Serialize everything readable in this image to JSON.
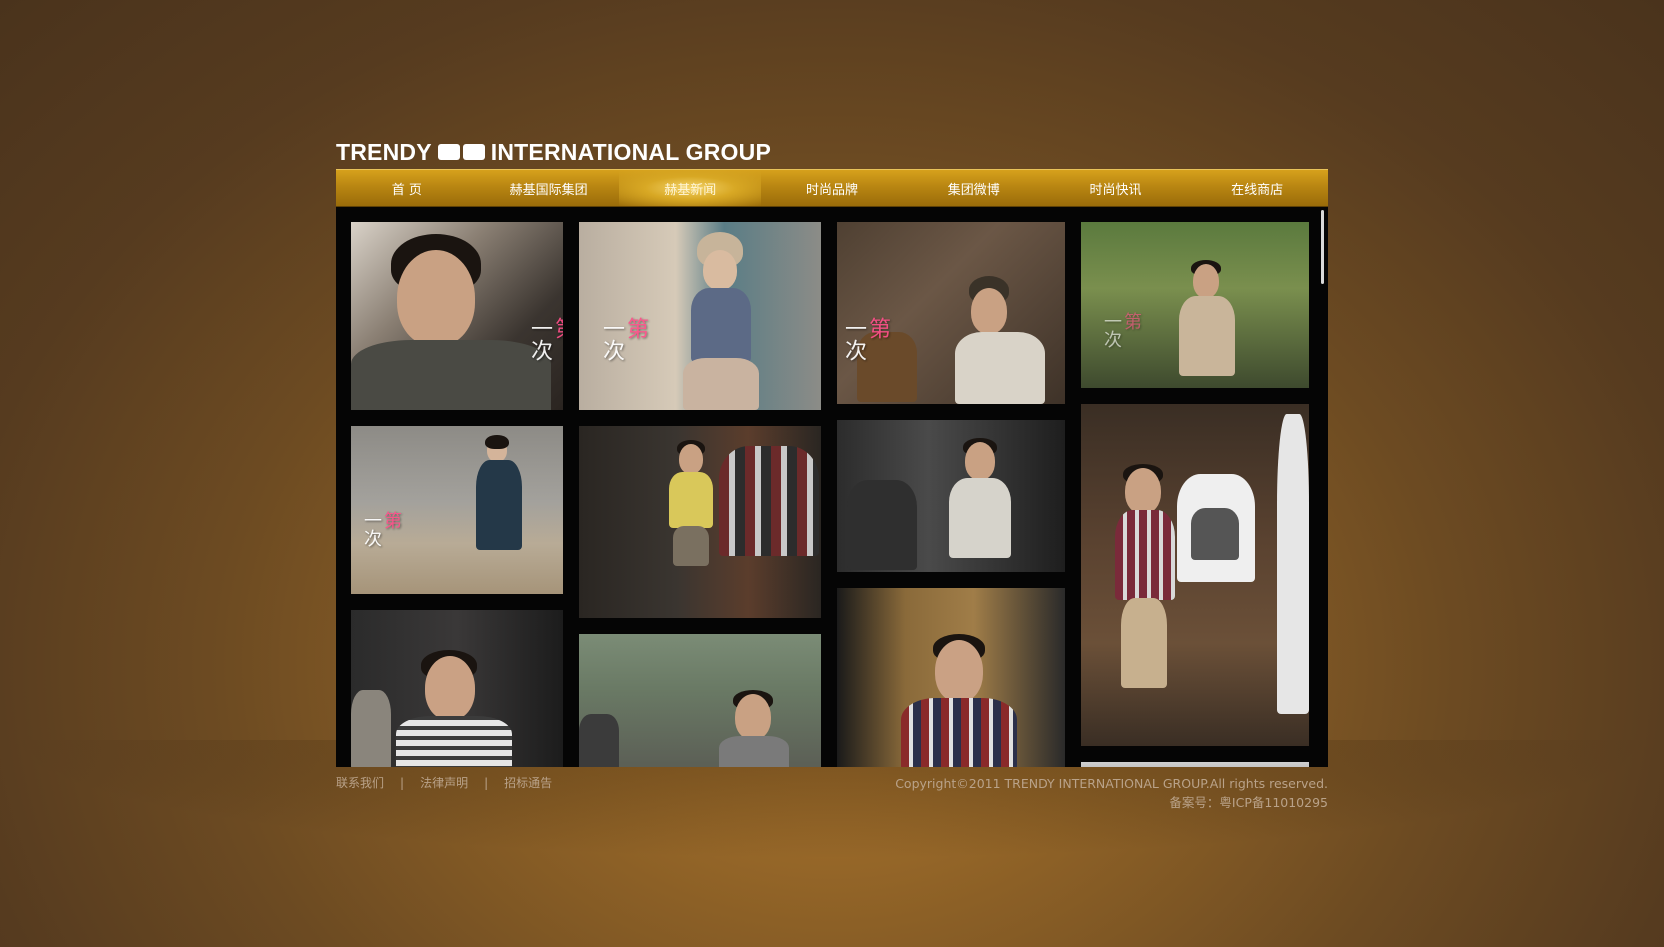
{
  "brand": {
    "logo_left": "TRENDY",
    "logo_right": "INTERNATIONAL GROUP"
  },
  "nav": {
    "items": [
      {
        "label": "首  页"
      },
      {
        "label": "赫基国际集团"
      },
      {
        "label": "赫基新闻",
        "active": true
      },
      {
        "label": "时尚品牌"
      },
      {
        "label": "集团微博"
      },
      {
        "label": "时尚快讯"
      },
      {
        "label": "在线商店"
      }
    ],
    "accent": "#c8930f",
    "active_glow": "#f4d46b"
  },
  "gallery": {
    "caption_text": "第一次",
    "photos": [
      {
        "name": "photo-man-portrait-window"
      },
      {
        "name": "photo-woman-knit-hat-street"
      },
      {
        "name": "photo-man-beanie-studio"
      },
      {
        "name": "photo-man-sitting-park"
      },
      {
        "name": "photo-woman-beach"
      },
      {
        "name": "photo-man-yellow-tee-store"
      },
      {
        "name": "photo-men-mirror-shop"
      },
      {
        "name": "photo-man-holding-shirt-store"
      },
      {
        "name": "photo-man-striped-shirt"
      },
      {
        "name": "photo-man-sunglasses-plaza"
      },
      {
        "name": "photo-man-plaid-shirt-interview"
      }
    ]
  },
  "footer": {
    "links": [
      "联系我们",
      "法律声明",
      "招标通告"
    ],
    "separator": "|",
    "copyright": "Copyright©2011 TRENDY INTERNATIONAL GROUP.All rights reserved.",
    "icp": "备案号：粤ICP备11010295"
  },
  "colors": {
    "background": "#6d4b22",
    "footer_text": "#b9a289"
  }
}
